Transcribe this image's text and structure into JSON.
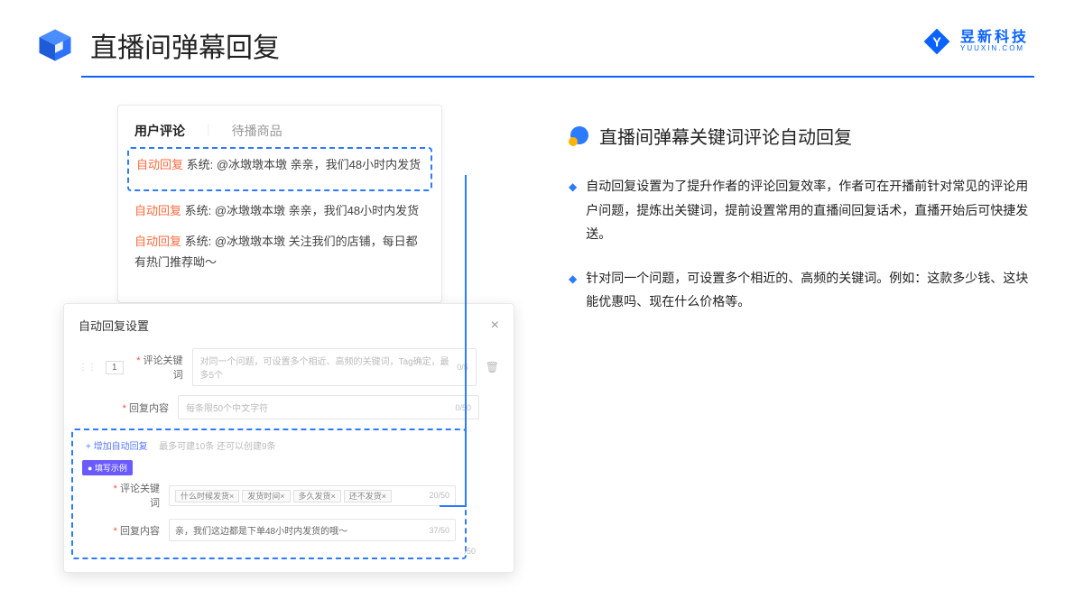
{
  "header": {
    "title": "直播间弹幕回复",
    "brand_cn": "昱新科技",
    "brand_en": "YUUXIN.COM"
  },
  "panel": {
    "tab1": "用户评论",
    "tab2": "待播商品",
    "c1_badge": "自动回复",
    "c1": " 系统: @冰墩墩本墩 亲亲，我们48小时内发货",
    "c2_badge": "自动回复",
    "c2": " 系统: @冰墩墩本墩 亲亲，我们48小时内发货",
    "c3_badge": "自动回复",
    "c3": " 系统: @冰墩墩本墩 关注我们的店铺，每日都有热门推荐呦～"
  },
  "modal": {
    "title": "自动回复设置",
    "idx": "1",
    "lbl_kw": "评论关键词",
    "ph_kw": "对同一个问题，可设置多个相近、高频的关键词，Tag确定，最多5个",
    "cnt_kw": "0/5",
    "lbl_ct": "回复内容",
    "ph_ct": "每条限50个中文字符",
    "cnt_ct": "0/50",
    "add": "+ 增加自动回复",
    "add_hint": "最多可建10条 还可以创建9条",
    "ex_badge": "● 填写示例",
    "ex_kw_lbl": "评论关键词",
    "ex_kw_tags": [
      "什么时候发货×",
      "发货时间×",
      "多久发货×",
      "还不发货×"
    ],
    "ex_kw_cnt": "20/50",
    "ex_ct_lbl": "回复内容",
    "ex_ct_val": "亲，我们这边都是下单48小时内发货的哦～",
    "ex_ct_cnt": "37/50",
    "outer_cnt": "/50"
  },
  "right": {
    "title": "直播间弹幕关键词评论自动回复",
    "b1": "自动回复设置为了提升作者的评论回复效率，作者可在开播前针对常见的评论用户问题，提炼出关键词，提前设置常用的直播间回复话术，直播开始后可快捷发送。",
    "b2": "针对同一个问题，可设置多个相近的、高频的关键词。例如：这款多少钱、这块能优惠吗、现在什么价格等。"
  }
}
